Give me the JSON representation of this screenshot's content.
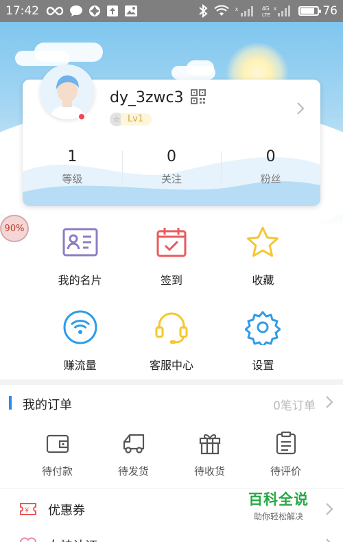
{
  "status_bar": {
    "time": "17:42",
    "battery": "76",
    "battery_level": 0.76,
    "network_label": "4G\nLTE",
    "icons": [
      "infinity-icon",
      "chat-bubble-icon",
      "pinwheel-icon",
      "upload-icon",
      "image-icon",
      "bluetooth-icon",
      "wifi-icon",
      "signal-icon",
      "lte-signal-icon",
      "battery-icon"
    ]
  },
  "profile": {
    "username": "dy_3zwc3",
    "level": "Lv1",
    "stats": [
      {
        "value": "1",
        "label": "等级"
      },
      {
        "value": "0",
        "label": "关注"
      },
      {
        "value": "0",
        "label": "粉丝"
      }
    ]
  },
  "side_badge": "90%",
  "features": [
    {
      "label": "我的名片",
      "icon": "business-card-icon"
    },
    {
      "label": "签到",
      "icon": "calendar-check-icon"
    },
    {
      "label": "收藏",
      "icon": "star-icon"
    },
    {
      "label": "赚流量",
      "icon": "wifi-icon"
    },
    {
      "label": "客服中心",
      "icon": "headset-icon"
    },
    {
      "label": "设置",
      "icon": "gear-icon"
    }
  ],
  "orders": {
    "title": "我的订单",
    "count_text": "0笔订单",
    "items": [
      {
        "label": "待付款",
        "icon": "wallet-icon"
      },
      {
        "label": "待发货",
        "icon": "truck-icon"
      },
      {
        "label": "待收货",
        "icon": "gift-box-icon"
      },
      {
        "label": "待评价",
        "icon": "clipboard-icon"
      }
    ]
  },
  "menu_rows": [
    {
      "label": "优惠券",
      "icon": "coupon-icon"
    },
    {
      "label": "女神认证",
      "icon": "heart-badge-icon"
    }
  ],
  "watermark": {
    "title": "百科全说",
    "subtitle": "助你轻松解决"
  },
  "colors": {
    "accent_blue": "#2a8cf0",
    "icon_purple": "#8e7cc3",
    "icon_red": "#ea5a5a",
    "icon_yellow": "#f5c630",
    "icon_blue": "#2f9ce8",
    "watermark_green": "#28a745"
  }
}
